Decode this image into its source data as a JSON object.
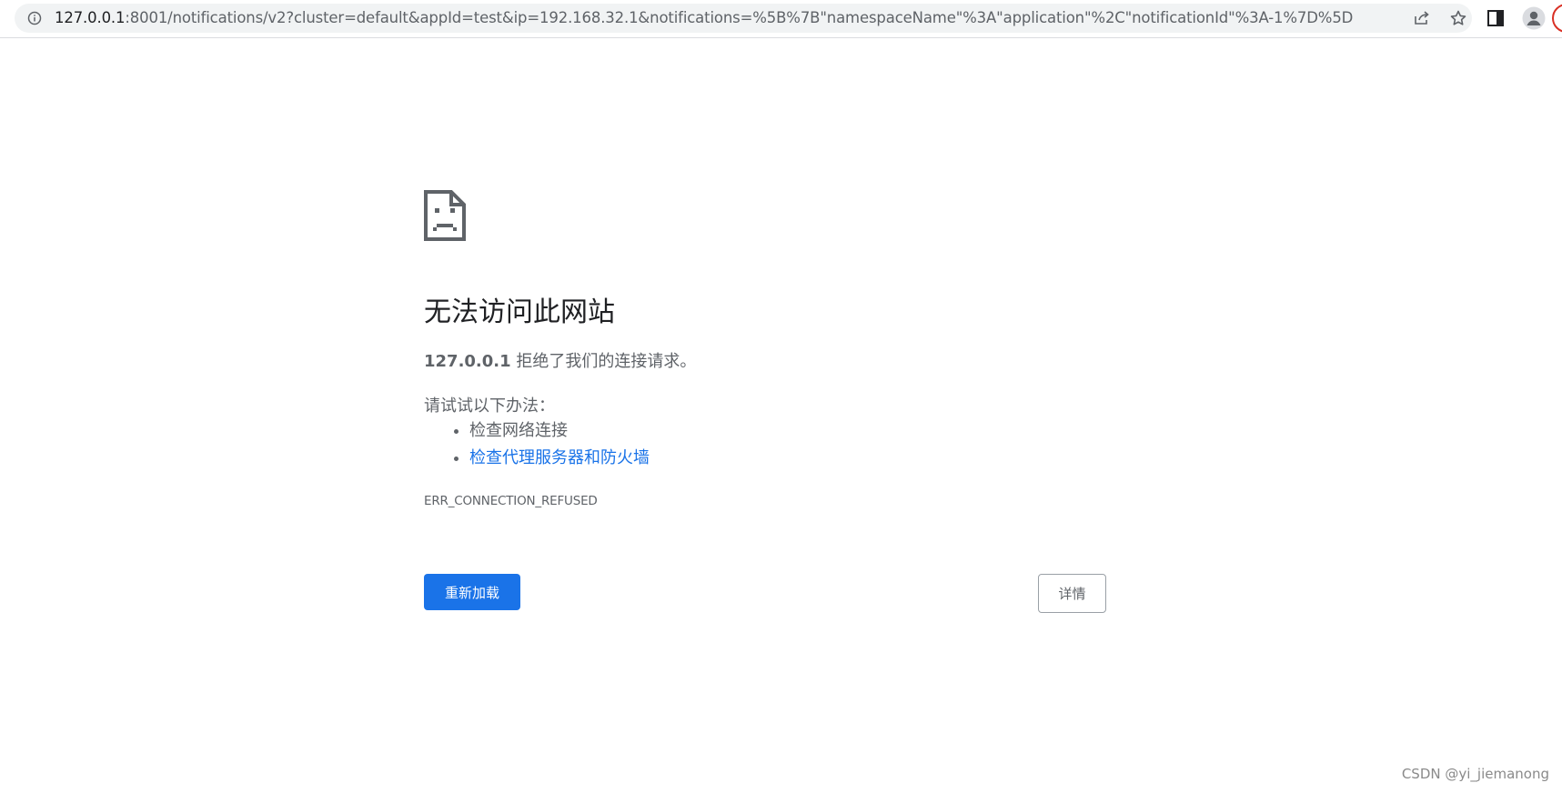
{
  "browser": {
    "url_host": "127.0.0.1",
    "url_rest": ":8001/notifications/v2?cluster=default&appId=test&ip=192.168.32.1&notifications=%5B%7B\"namespaceName\"%3A\"application\"%2C\"notificationId\"%3A-1%7D%5D",
    "icons": {
      "site_info": "info-icon",
      "share": "share-icon",
      "bookmark": "star-icon",
      "side_panel": "side-panel-icon",
      "profile": "profile-icon"
    }
  },
  "error_page": {
    "icon": "sad-page-icon",
    "title": "无法访问此网站",
    "host": "127.0.0.1",
    "message": " 拒绝了我们的连接请求。",
    "suggestions_intro": "请试试以下办法：",
    "suggestions": [
      {
        "text": "检查网络连接",
        "is_link": false
      },
      {
        "text": "检查代理服务器和防火墙",
        "is_link": true
      }
    ],
    "error_code": "ERR_CONNECTION_REFUSED",
    "reload_label": "重新加载",
    "details_label": "详情"
  },
  "watermark": "CSDN @yi_jiemanong",
  "colors": {
    "accent": "#1a73e8",
    "text_primary": "#202124",
    "text_secondary": "#5f6368",
    "omnibox_bg": "#f1f3f4"
  }
}
